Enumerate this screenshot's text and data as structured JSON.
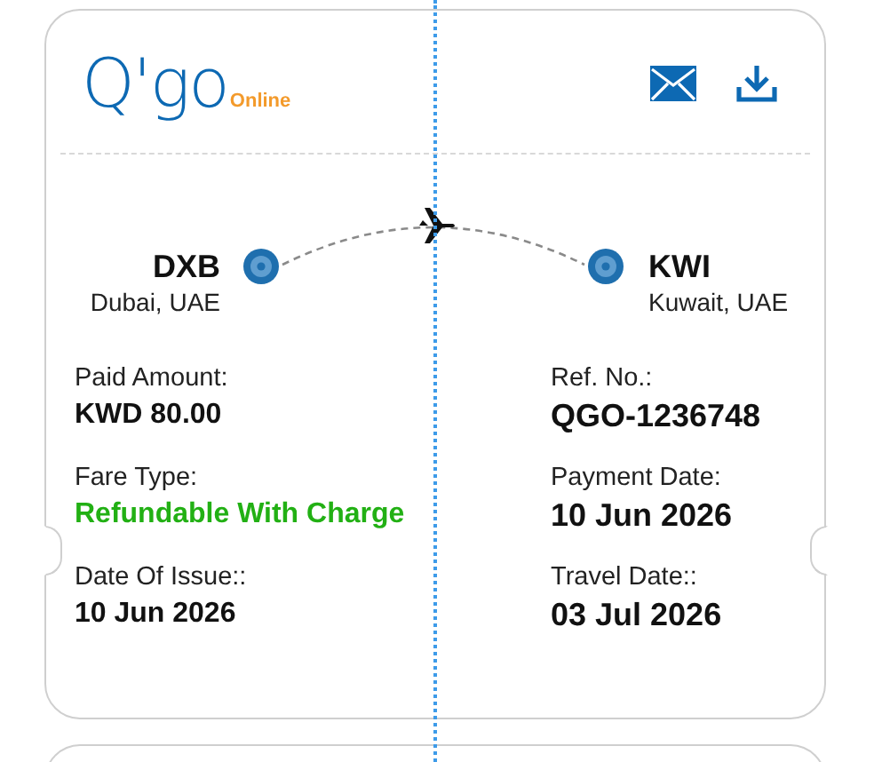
{
  "logo": {
    "name": "Q'go",
    "sub": "Online"
  },
  "actions": [
    {
      "kind": "email"
    },
    {
      "kind": "download"
    }
  ],
  "route": {
    "from": {
      "code": "DXB",
      "city": "Dubai, UAE"
    },
    "to": {
      "code": "KWI",
      "city": "Kuwait, UAE"
    }
  },
  "details": {
    "left": [
      {
        "label": "Paid Amount:",
        "value": "KWD 80.00",
        "color": "#111111"
      },
      {
        "label": "Fare Type:",
        "value": "Refundable With Charge",
        "color": "#22b014"
      },
      {
        "label": "Date Of Issue::",
        "value": "10 Jun 2026",
        "color": "#111111"
      }
    ],
    "right": [
      {
        "label": "Ref. No.:",
        "value": "QGO-1236748",
        "color": "#111111"
      },
      {
        "label": "Payment Date:",
        "value": "10 Jun 2026",
        "color": "#111111"
      },
      {
        "label": "Travel Date::",
        "value": "03 Jul 2026",
        "color": "#111111"
      }
    ]
  }
}
